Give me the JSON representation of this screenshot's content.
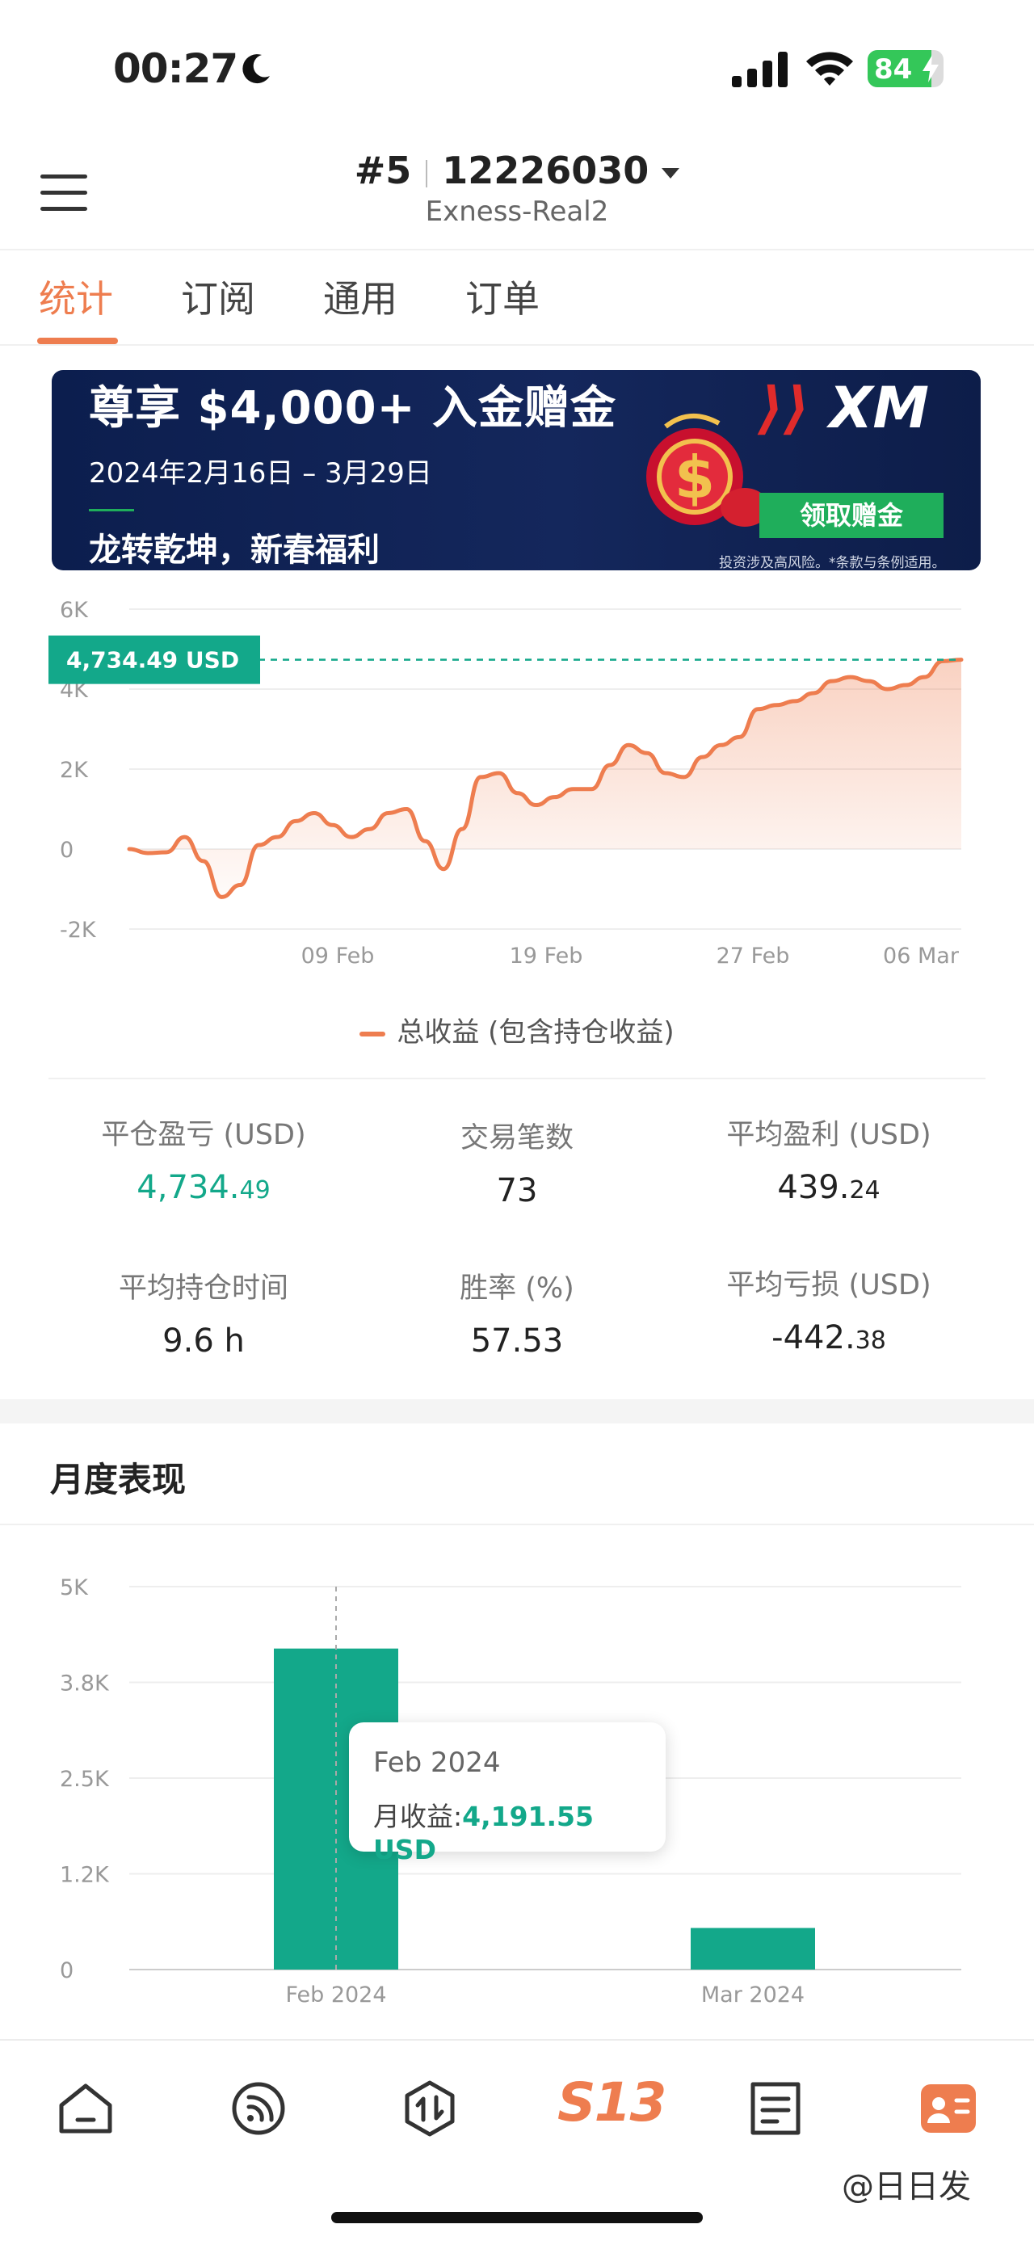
{
  "status_bar": {
    "time": "00:27",
    "battery": "84",
    "battery_level": 0.84
  },
  "header": {
    "account_index": "#5",
    "account_number": "12226030",
    "server": "Exness-Real2"
  },
  "tabs": [
    {
      "label": "统计"
    },
    {
      "label": "订阅"
    },
    {
      "label": "通用"
    },
    {
      "label": "订单"
    }
  ],
  "banner": {
    "title": "尊享 $4,000+ 入金赠金",
    "date_range": "2024年2月16日 – 3月29日",
    "subtitle": "龙转乾坤，新春福利",
    "brand": "XM",
    "cta": "领取赠金",
    "disclaimer": "投资涉及高风险。*条款与条例适用。"
  },
  "legend": {
    "label": "总收益 (包含持仓收益)"
  },
  "stats": {
    "closed_pl": {
      "label": "平仓盈亏 (USD)",
      "int": "4,734.",
      "frac": "49"
    },
    "trades": {
      "label": "交易笔数",
      "value": "73"
    },
    "avg_profit": {
      "label": "平均盈利 (USD)",
      "int": "439.",
      "frac": "24"
    },
    "avg_hold": {
      "label": "平均持仓时间",
      "value": "9.6 h"
    },
    "win_rate": {
      "label": "胜率 (%)",
      "value": "57.53"
    },
    "avg_loss": {
      "label": "平均亏损 (USD)",
      "int": "-442.",
      "frac": "38"
    }
  },
  "monthly": {
    "title": "月度表现",
    "tooltip": {
      "month": "Feb 2024",
      "label": "月收益:",
      "value": "4,191.55 USD"
    }
  },
  "watermark": "@日日发",
  "colors": {
    "accent": "#ee7d4f",
    "green": "#13a88a",
    "line_label_bg": "#13a88a"
  },
  "chart_data": [
    {
      "type": "area",
      "yticks": [
        "6K",
        "4K",
        "2K",
        "0",
        "-2K"
      ],
      "ylim": [
        -2000,
        6000
      ],
      "xticks": [
        "09 Feb",
        "19 Feb",
        "27 Feb",
        "06 Mar"
      ],
      "current_label": "4,734.49 USD",
      "current_value": 4734.49,
      "series": [
        {
          "name": "总收益 (包含持仓收益)",
          "values": [
            0,
            -100,
            -80,
            300,
            -300,
            -1200,
            -900,
            100,
            300,
            700,
            900,
            600,
            300,
            500,
            900,
            1000,
            200,
            -500,
            500,
            1800,
            1900,
            1400,
            1100,
            1300,
            1500,
            1500,
            2100,
            2600,
            2400,
            1900,
            1800,
            2300,
            2600,
            2800,
            3500,
            3600,
            3700,
            3900,
            4200,
            4300,
            4200,
            4000,
            4100,
            4300,
            4700,
            4734.49
          ]
        }
      ]
    },
    {
      "type": "bar",
      "yticks": [
        "5K",
        "3.8K",
        "2.5K",
        "1.2K",
        "0"
      ],
      "ylim": [
        0,
        5000
      ],
      "categories": [
        "Feb 2024",
        "Mar 2024"
      ],
      "values": [
        4191.55,
        542.94
      ]
    }
  ]
}
